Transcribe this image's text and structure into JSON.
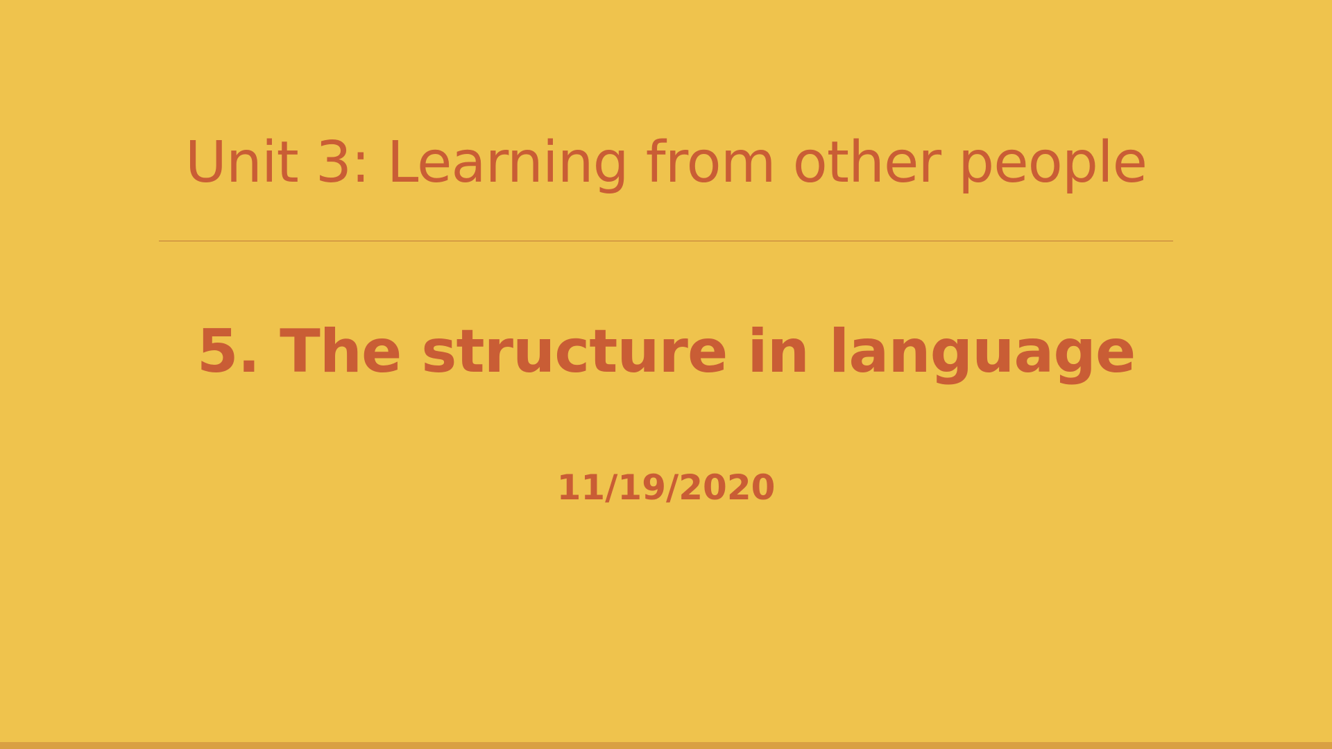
{
  "slide": {
    "title": "Unit 3: Learning from other people",
    "subtitle": "5. The structure in language",
    "date": "11/19/2020"
  },
  "colors": {
    "background": "#EFC34D",
    "text": "#C95D35",
    "divider": "#BE7A3A",
    "bottom_bar": "#D9A043"
  }
}
